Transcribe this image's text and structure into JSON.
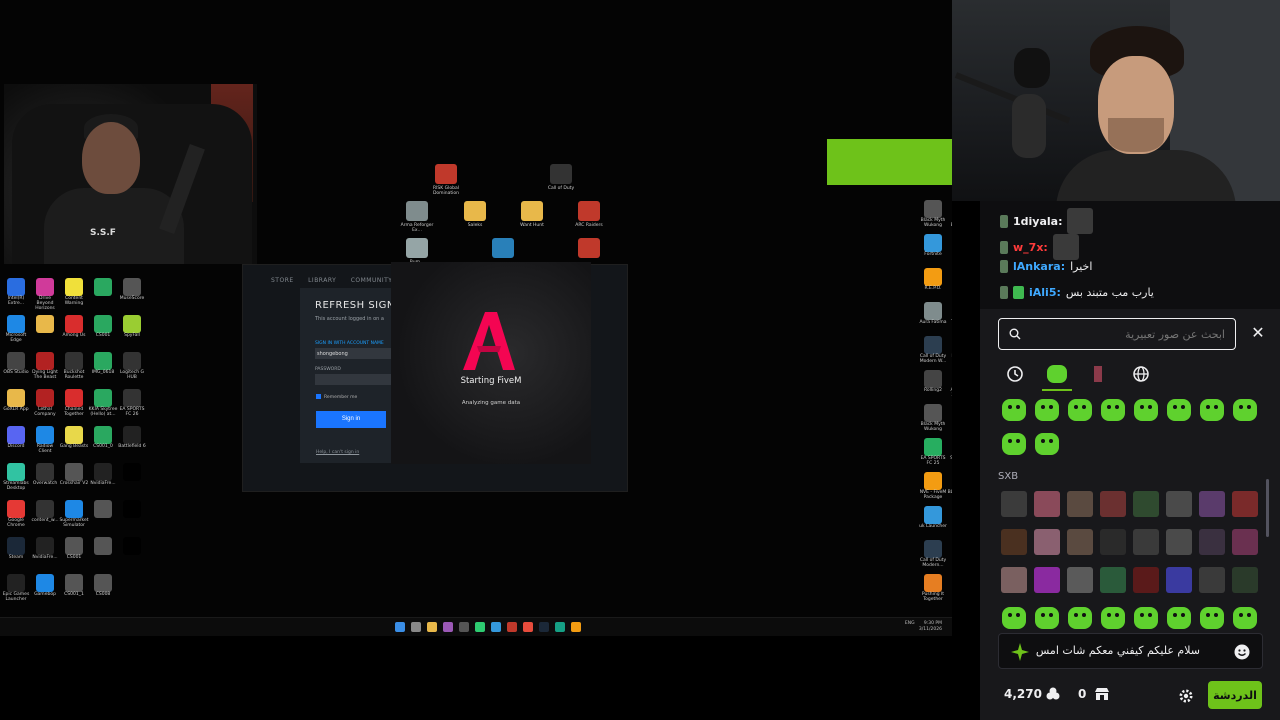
{
  "desktop": {
    "small_cam_shirt_text": "S.S.F",
    "left_icons": [
      {
        "label": "Intel(R) Extre...",
        "color": "#2a6de0"
      },
      {
        "label": "Drive Beyond Horizons",
        "color": "#d03a9a"
      },
      {
        "label": "Content Warning",
        "color": "#f0e03a"
      },
      {
        "label": "",
        "color": "#2aa860"
      },
      {
        "label": "MuseScore",
        "color": "#555555"
      },
      {
        "label": "Microsoft Edge",
        "color": "#1e88e5"
      },
      {
        "label": "",
        "color": "#e8b84a"
      },
      {
        "label": "Among Us",
        "color": "#d92d2d"
      },
      {
        "label": "CS001",
        "color": "#2aa860"
      },
      {
        "label": "SpyFall",
        "color": "#9acd32"
      },
      {
        "label": "OBS Studio",
        "color": "#444444"
      },
      {
        "label": "Dying Light The Beast",
        "color": "#b22222"
      },
      {
        "label": "Buckshot Roulette",
        "color": "#333333"
      },
      {
        "label": "IMG_0618",
        "color": "#2aa860"
      },
      {
        "label": "Logitech G HUB",
        "color": "#333333"
      },
      {
        "label": "GoXLR App",
        "color": "#e8b84a"
      },
      {
        "label": "Lethal Company",
        "color": "#b22222"
      },
      {
        "label": "Chained Together",
        "color": "#d92d2d"
      },
      {
        "label": "KKIA Skytree (Hello) at...",
        "color": "#2aa860"
      },
      {
        "label": "EA SPORTS FC 26",
        "color": "#333333"
      },
      {
        "label": "Discord",
        "color": "#5865f2"
      },
      {
        "label": "Radiow Client",
        "color": "#1e88e5"
      },
      {
        "label": "Gang Beasts",
        "color": "#e8d84a"
      },
      {
        "label": "CS001_0",
        "color": "#2aa860"
      },
      {
        "label": "Battlefield 6",
        "color": "#222222"
      },
      {
        "label": "Streamlabs Desktop",
        "color": "#31c3a2"
      },
      {
        "label": "Overwatch",
        "color": "#333333"
      },
      {
        "label": "Crosshair V2",
        "color": "#555555"
      },
      {
        "label": "NvidiaFre...",
        "color": "#222222"
      },
      {
        "label": "",
        "color": "#000000"
      },
      {
        "label": "Google Chrome",
        "color": "#e53935"
      },
      {
        "label": "content_w...",
        "color": "#333333"
      },
      {
        "label": "Supermarket Simulator",
        "color": "#1e88e5"
      },
      {
        "label": "",
        "color": "#555555"
      },
      {
        "label": "",
        "color": "#000000"
      },
      {
        "label": "Steam",
        "color": "#1b2838"
      },
      {
        "label": "NvidiaFre...",
        "color": "#222222"
      },
      {
        "label": "CS001",
        "color": "#555555"
      },
      {
        "label": "",
        "color": "#555555"
      },
      {
        "label": "",
        "color": "#000000"
      },
      {
        "label": "Epic Games Launcher",
        "color": "#222222"
      },
      {
        "label": "Gamebop",
        "color": "#1e88e5"
      },
      {
        "label": "CS001_1",
        "color": "#555555"
      },
      {
        "label": "CS008",
        "color": "#555555"
      }
    ],
    "center_icons": [
      {
        "label": "RISK Global Domination",
        "color": "#c0392b"
      },
      {
        "label": "Call of Duty",
        "color": "#333333"
      },
      {
        "label": "Arma Reforger Ex...",
        "color": "#7f8c8d"
      },
      {
        "label": "Saleks",
        "color": "#e8b84a"
      },
      {
        "label": "Want Hunt",
        "color": "#e8b84a"
      },
      {
        "label": "ARC Raiders",
        "color": "#c0392b"
      },
      {
        "label": "Bum...",
        "color": "#95a5a6"
      },
      {
        "label": "",
        "color": "#2980b9"
      },
      {
        "label": "",
        "color": "#c0392b"
      }
    ],
    "right_icons": [
      {
        "label": "Black Myth Wukong",
        "color": "#555555"
      },
      {
        "label": "Crash Bandicoot",
        "color": "#333333"
      },
      {
        "label": "Fortnite",
        "color": "#3498db"
      },
      {
        "label": "Rubber Bandits",
        "color": "#e67e22"
      },
      {
        "label": "R.E.P.O.",
        "color": "#f39c12"
      },
      {
        "label": "Pummel Party",
        "color": "#e74c3c"
      },
      {
        "label": "Aura Fatima",
        "color": "#7f8c8d"
      },
      {
        "label": "TEKKEN 8",
        "color": "#c0392b"
      },
      {
        "label": "Call of Duty Modern W...",
        "color": "#2c3e50"
      },
      {
        "label": "Liar's Bar",
        "color": "#8e1b1b"
      },
      {
        "label": "Rolling2",
        "color": "#444444"
      },
      {
        "label": "Among Us 3D Demo",
        "color": "#c0392b"
      },
      {
        "label": "Black Myth Wukong",
        "color": "#555555"
      },
      {
        "label": "DON'T SCREAM",
        "color": "#8e1b1b"
      },
      {
        "label": "EA SPORTS FC 25",
        "color": "#27ae60"
      },
      {
        "label": "SHOTBALL",
        "color": "#16a085"
      },
      {
        "label": "NVE - FiveM Package",
        "color": "#f39c12"
      },
      {
        "label": "BLOODSTR...",
        "color": "#16a085"
      },
      {
        "label": "uk Launcher",
        "color": "#3498db"
      },
      {
        "label": "Arma 3",
        "color": "#7f8c8d"
      },
      {
        "label": "Call of Duty Modern...",
        "color": "#2c3e50"
      },
      {
        "label": "Rocket League",
        "color": "#eeeeee"
      },
      {
        "label": "Pushing It Together",
        "color": "#e67e22"
      },
      {
        "label": "Arma Reforger",
        "color": "#7f8c8d"
      }
    ],
    "launcher": {
      "nav": [
        "STORE",
        "LIBRARY",
        "COMMUNITY"
      ],
      "signin_title": "REFRESH SIGN I",
      "signin_sub": "This account logged in on a",
      "account_label": "SIGN IN WITH ACCOUNT NAME",
      "account_value": "shongebong",
      "password_label": "PASSWORD",
      "remember": "Remember me",
      "signin_button": "Sign in",
      "help_link": "Help, I can't sign in"
    },
    "fivem": {
      "title": "Starting FiveM",
      "status": "Analyzing game data",
      "accent": "#f40552"
    },
    "taskbar": {
      "lang": "ENG",
      "time": "9:30 PM",
      "date": "3/11/2026"
    }
  },
  "chat": {
    "messages": [
      {
        "user": "1diyala:",
        "text": "",
        "user_color": "#efeff1",
        "badge_color": "#5a7a5a",
        "has_emote": true
      },
      {
        "user": "w_7x:",
        "text": "",
        "user_color": "#ff3b3b",
        "badge_color": "#5a7a5a",
        "has_emote": true
      },
      {
        "user": "lAnkara:",
        "text": "اخيرا",
        "user_color": "#3fa9ff",
        "badge_color": "#5a7a5a",
        "has_emote": false
      },
      {
        "user": "iAli5:",
        "text": "يارب مب متبند بس",
        "user_color": "#3fa9ff",
        "badge_color": "#5a7a5a",
        "has_emote": false
      }
    ],
    "search_placeholder": "ابحث عن صور تعبيرية",
    "section_label": "SXB",
    "input_text": "سلام عليكم كيفني معكم شات امس",
    "points": "4,270",
    "zero_count": "0",
    "chat_button": "الدردشة",
    "accent": "#6ec21a"
  }
}
